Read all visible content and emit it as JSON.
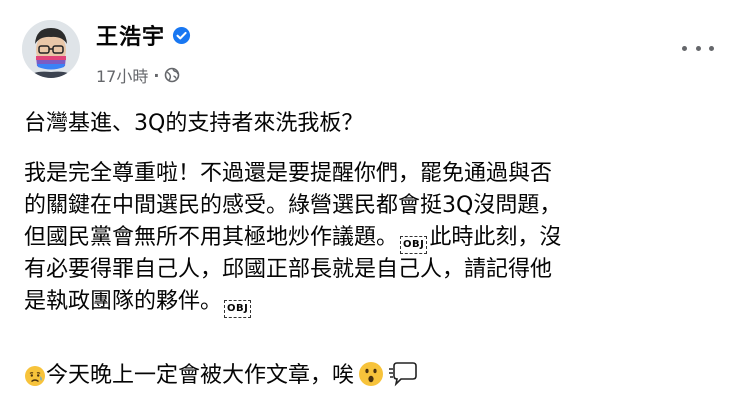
{
  "author": {
    "name": "王浩宇",
    "verified": true
  },
  "meta": {
    "time": "17小時",
    "separator": "·",
    "audience_icon": "globe-icon"
  },
  "more_menu_icon": "more-options-icon",
  "post": {
    "headline": "台灣基進、3Q的支持者來洗我板？",
    "paragraph_lines": [
      "我是完全尊重啦！不過還是要提醒你們，罷免通過與否",
      "的關鍵在中間選民的感受。綠營選民都會挺3Q沒問題，",
      "但國民黨會無所不用其極地炒作議題。",
      "此時此刻，沒",
      "有必要得罪自己人，邱國正部長就是自己人，請記得他",
      "是執政團隊的夥伴。"
    ],
    "obj_marker": "OBJ",
    "closing": "今天晚上一定會被大作文章，唉",
    "emojis": [
      "sad-relieved-face-emoji",
      "hushed-face-emoji",
      "speech-balloon-emoji"
    ]
  },
  "colors": {
    "text": "#050505",
    "secondary": "#65676b",
    "verified_blue": "#1877f2"
  }
}
